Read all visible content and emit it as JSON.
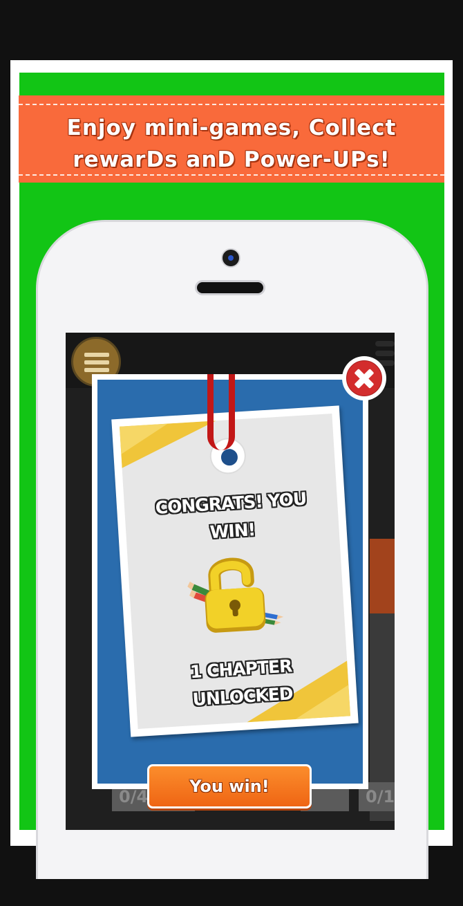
{
  "banner": {
    "line1": "Enjoy mini-games, Collect",
    "line2": "rewarDs anD Power-UPs!"
  },
  "background": {
    "ghost_counter_left": "0/4",
    "ghost_counter_right": "0/1"
  },
  "popup": {
    "congrats_line1": "CONGRATS! YOU",
    "congrats_line2": "WIN!",
    "unlock_line1": "1 CHAPTER",
    "unlock_line2": "UNLOCKED",
    "button_label": "You win!"
  },
  "icons": {
    "close": "close-icon",
    "menu": "menu-icon",
    "lock": "padlock-open-icon",
    "pencil": "pencil-icon"
  },
  "colors": {
    "green_background": "#12c515",
    "banner_orange": "#f96a3b",
    "modal_blue": "#2a6cad",
    "button_orange": "#ef6514",
    "close_red": "#d32d2d",
    "lock_yellow": "#f2d128"
  }
}
